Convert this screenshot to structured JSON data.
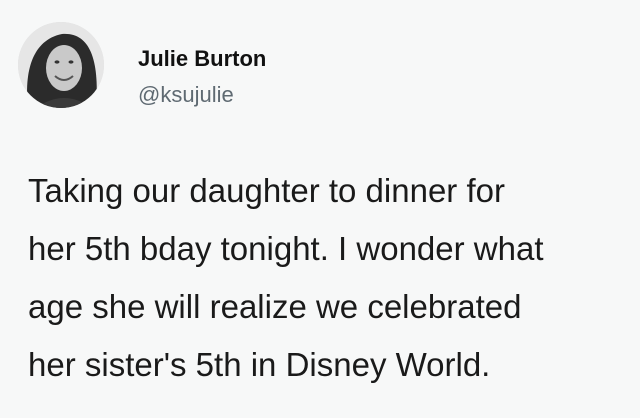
{
  "tweet": {
    "author": {
      "display_name": "Julie Burton",
      "handle": "@ksujulie",
      "avatar_icon": "profile-photo"
    },
    "text_lines": [
      "Taking our daughter to dinner for",
      "her 5th bday tonight. I wonder what",
      "age she will realize we celebrated",
      "her sister's 5th in Disney World."
    ]
  }
}
